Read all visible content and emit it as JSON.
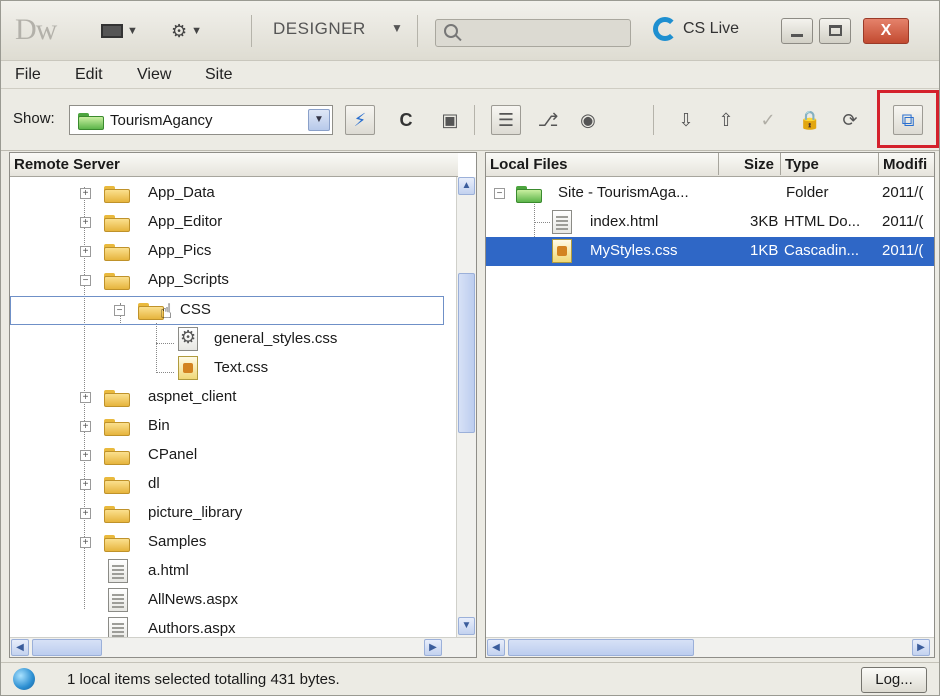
{
  "titlebar": {
    "app_logo": "Dw",
    "workspace_label": "DESIGNER",
    "search_placeholder": "",
    "cslive_label": "CS Live",
    "close_glyph": "X"
  },
  "menubar": {
    "items": [
      "File",
      "Edit",
      "View",
      "Site"
    ]
  },
  "toolbar": {
    "show_label": "Show:",
    "site_value": "TourismAgancy"
  },
  "remote_panel": {
    "header": "Remote Server",
    "rows": [
      {
        "label": "App_Data"
      },
      {
        "label": "App_Editor"
      },
      {
        "label": "App_Pics"
      },
      {
        "label": "App_Scripts"
      },
      {
        "label": "CSS"
      },
      {
        "label": "general_styles.css"
      },
      {
        "label": "Text.css"
      },
      {
        "label": "aspnet_client"
      },
      {
        "label": "Bin"
      },
      {
        "label": "CPanel"
      },
      {
        "label": "dl"
      },
      {
        "label": "picture_library"
      },
      {
        "label": "Samples"
      },
      {
        "label": "a.html"
      },
      {
        "label": "AllNews.aspx"
      },
      {
        "label": "Authors.aspx"
      }
    ]
  },
  "local_panel": {
    "headers": {
      "name": "Local Files",
      "size": "Size",
      "type": "Type",
      "modified": "Modifi"
    },
    "rows": [
      {
        "name": "Site - TourismAga...",
        "size": "",
        "type": "Folder",
        "modified": "2011/("
      },
      {
        "name": "index.html",
        "size": "3KB",
        "type": "HTML Do...",
        "modified": "2011/("
      },
      {
        "name": "MyStyles.css",
        "size": "1KB",
        "type": "Cascadin...",
        "modified": "2011/("
      }
    ]
  },
  "statusbar": {
    "text": "1 local items selected totalling 431 bytes.",
    "log_button": "Log..."
  },
  "colors": {
    "selection": "#2f67c6",
    "highlight_box": "#d4212c",
    "folder": "#e6b43d",
    "site_folder": "#5db54a"
  }
}
